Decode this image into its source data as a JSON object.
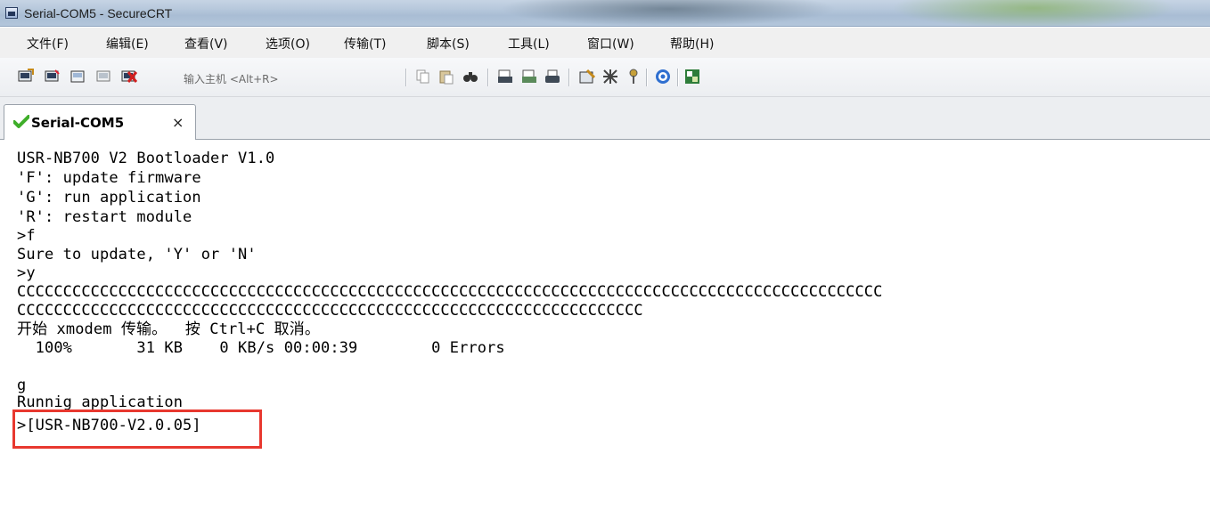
{
  "window": {
    "title": "Serial-COM5 - SecureCRT"
  },
  "menu": [
    "文件(F)",
    "编辑(E)",
    "查看(V)",
    "选项(O)",
    "传输(T)",
    "脚本(S)",
    "工具(L)",
    "窗口(W)",
    "帮助(H)"
  ],
  "toolbar": {
    "host_placeholder": "输入主机 <Alt+R>",
    "icons": [
      "connect-icon",
      "quick-connect-icon",
      "connect-tab-icon",
      "reconnect-icon",
      "disconnect-icon",
      "copy-icon",
      "paste-icon",
      "find-icon",
      "print-setup-icon",
      "print-selection-icon",
      "print-icon",
      "session-options-icon",
      "global-options-icon",
      "keymap-icon",
      "help-icon",
      "sftp-icon"
    ]
  },
  "tab": {
    "label": "Serial-COM5",
    "close": "×",
    "status_color": "#3fae2a"
  },
  "terminal": {
    "lines": [
      "USR-NB700 V2 Bootloader V1.0",
      "'F': update firmware",
      "'G': run application",
      "'R': restart module",
      ">f",
      "Sure to update, 'Y' or 'N'",
      ">y",
      "CCCCCCCCCCCCCCCCCCCCCCCCCCCCCCCCCCCCCCCCCCCCCCCCCCCCCCCCCCCCCCCCCCCCCCCCCCCCCCCCCCCCCCCCCCCCCC",
      "CCCCCCCCCCCCCCCCCCCCCCCCCCCCCCCCCCCCCCCCCCCCCCCCCCCCCCCCCCCCCCCCCCCC",
      "开始 xmodem 传输。  按 Ctrl+C 取消。",
      "  100%       31 KB    0 KB/s 00:00:39        0 Errors",
      "",
      "g",
      "Runnig application",
      ">[USR-NB700-V2.0.05]"
    ],
    "highlight_color": "#e8382f"
  }
}
